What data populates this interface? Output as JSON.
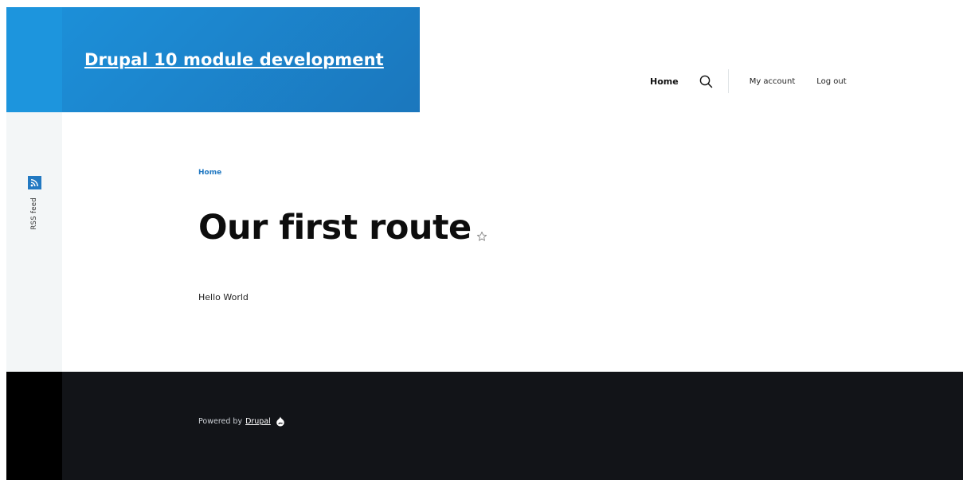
{
  "site": {
    "name": "Drupal 10 module development",
    "brand_color": "#1d8cd6"
  },
  "nav": {
    "home": "Home",
    "search_icon": "search-icon",
    "my_account": "My account",
    "log_out": "Log out"
  },
  "social": {
    "rss_label": "RSS feed",
    "rss_icon": "rss-icon"
  },
  "content": {
    "breadcrumb_home": "Home",
    "title": "Our first route",
    "shortcut_icon": "star-icon",
    "body": "Hello World"
  },
  "footer": {
    "powered_prefix": "Powered by",
    "drupal_link": "Drupal",
    "drupal_icon": "drupal-drop-icon",
    "background": "#121418"
  }
}
